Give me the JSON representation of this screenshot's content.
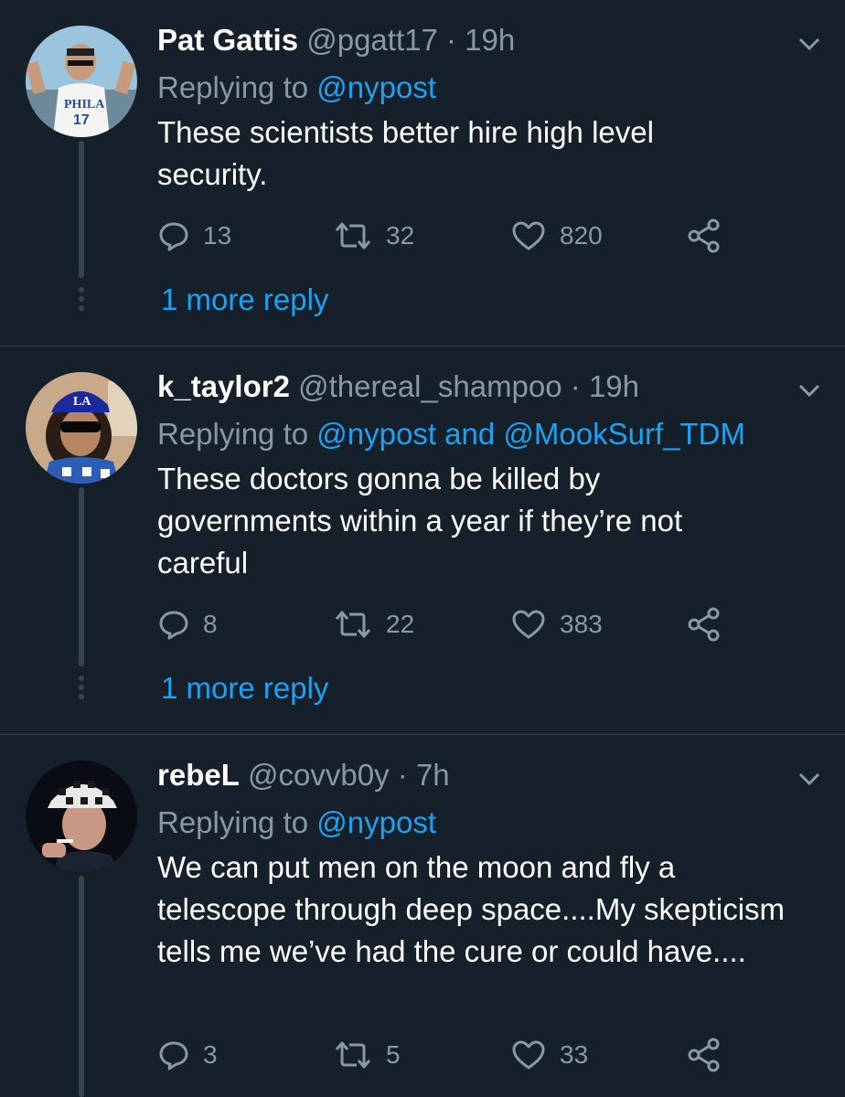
{
  "colors": {
    "background": "#15202b",
    "text": "#ffffff",
    "muted": "#8899a6",
    "accent": "#1da1f2",
    "divider": "#38444d"
  },
  "tweets": [
    {
      "name": "Pat Gattis",
      "handle": "@pgatt17",
      "time": "19h",
      "replying_prefix": "Replying to",
      "mentions": "@nypost",
      "text": "These scientists better hire high level security.",
      "replies": "13",
      "retweets": "32",
      "likes": "820",
      "more_reply": "1 more reply"
    },
    {
      "name": "k_taylor2",
      "handle": "@thereal_shampoo",
      "time": "19h",
      "replying_prefix": "Replying to",
      "mentions": "@nypost and @MookSurf_TDM",
      "text": "These doctors gonna be killed by governments within a year if they’re not careful",
      "replies": "8",
      "retweets": "22",
      "likes": "383",
      "more_reply": "1 more reply"
    },
    {
      "name": "rebeL",
      "handle": "@covvb0y",
      "time": "7h",
      "replying_prefix": "Replying to",
      "mentions": "@nypost",
      "text": "We can put men on the moon and fly a telescope through deep space....My skepticism tells me we’ve had the cure or could have....",
      "replies": "3",
      "retweets": "5",
      "likes": "33"
    }
  ],
  "icons": [
    "reply-icon",
    "retweet-icon",
    "like-icon",
    "share-icon",
    "chevron-down-icon"
  ]
}
